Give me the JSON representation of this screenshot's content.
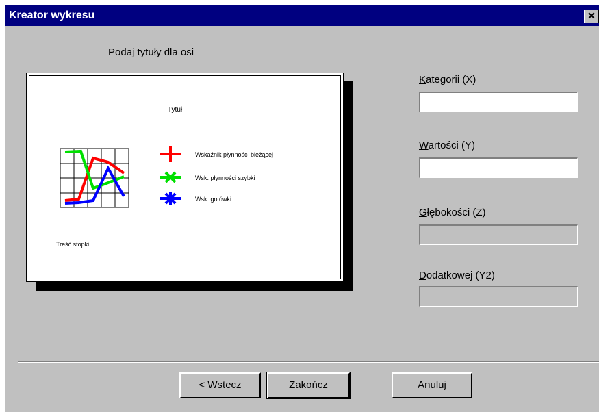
{
  "window": {
    "title": "Kreator wykresu",
    "close_glyph": "✕"
  },
  "heading": "Podaj tytuły dla osi",
  "preview": {
    "chart_title": "Tytuł",
    "footer_text": "Treść stopki",
    "legend": [
      {
        "label": "Wskaźnik płynności bieżącej",
        "color": "#ff0000",
        "marker": "plus"
      },
      {
        "label": "Wsk. płynności szybki",
        "color": "#00e000",
        "marker": "cross"
      },
      {
        "label": "Wsk. gotówki",
        "color": "#0000ff",
        "marker": "asterisk"
      }
    ]
  },
  "fields": [
    {
      "key": "X",
      "accesskey": "K",
      "label_rest": "ategorii (X)",
      "value": "",
      "enabled": true
    },
    {
      "key": "Y",
      "accesskey": "W",
      "label_rest": "artości (Y)",
      "value": "",
      "enabled": true
    },
    {
      "key": "Z",
      "accesskey": "G",
      "label_rest": "łębokości (Z)",
      "value": "",
      "enabled": false
    },
    {
      "key": "Y2",
      "accesskey": "D",
      "label_rest": "odatkowej (Y2)",
      "value": "",
      "enabled": false
    }
  ],
  "buttons": {
    "back": {
      "accesskey": "<",
      "rest": " Wstecz"
    },
    "finish": {
      "accesskey": "Z",
      "rest": "akończ"
    },
    "cancel": {
      "accesskey": "A",
      "rest": "nuluj"
    }
  }
}
